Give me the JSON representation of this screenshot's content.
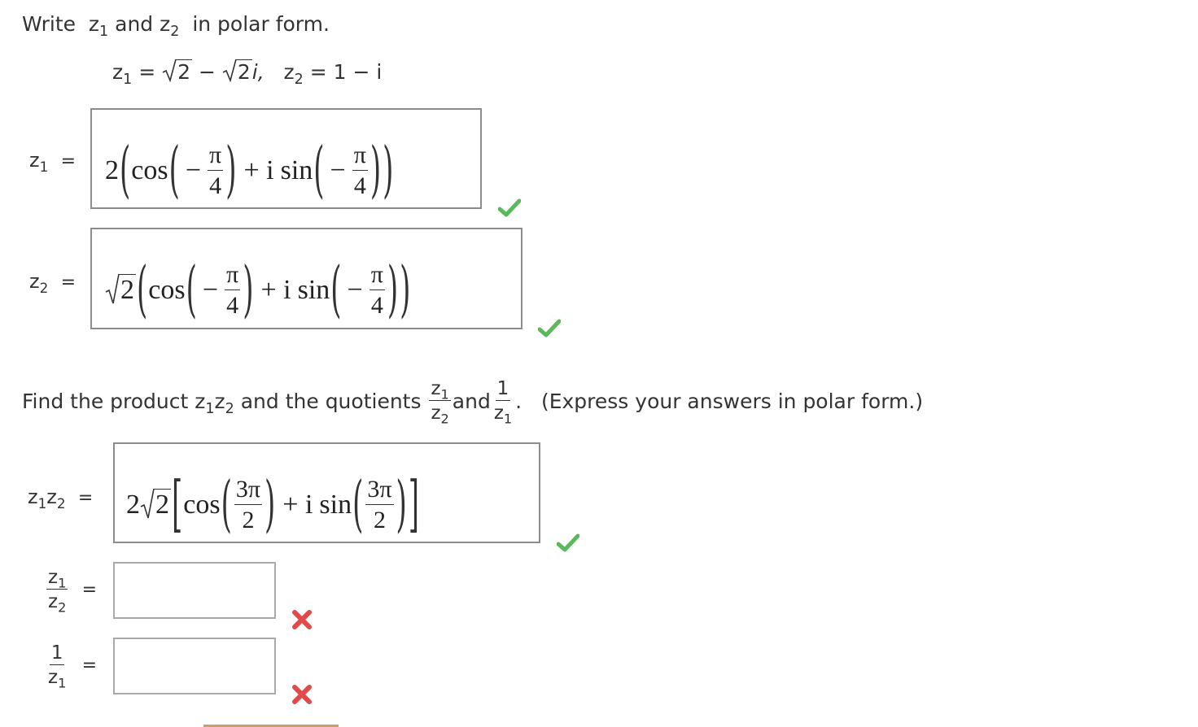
{
  "problem": {
    "prompt_prefix": "Write",
    "prompt_and": "and",
    "prompt_suffix": "in polar form.",
    "z1_label": "z",
    "z2_label": "z",
    "sub1": "1",
    "sub2": "2",
    "given_z1_eq": "=",
    "given_two": "2",
    "given_minus": "−",
    "given_two_i": "2",
    "given_i": "i,",
    "given_z2_rhs": "= 1 − i"
  },
  "answers_part1": {
    "z1": {
      "label": "z",
      "sub": "1",
      "equals": "=",
      "value": {
        "coef": "2",
        "cos": "cos",
        "sin": "sin",
        "plus_i": "+ i",
        "minus": "−",
        "num": "π",
        "den": "4"
      },
      "status": "correct"
    },
    "z2": {
      "label": "z",
      "sub": "2",
      "equals": "=",
      "value": {
        "coef": "2",
        "cos": "cos",
        "sin": "sin",
        "plus_i": "+ i",
        "minus": "−",
        "num": "π",
        "den": "4"
      },
      "status": "correct"
    }
  },
  "part2": {
    "text_find": "Find the product",
    "text_and_quotients": "and the quotients",
    "text_and": "and",
    "text_one": "1",
    "text_express": "(Express your answers in polar form.)",
    "product": {
      "equals": "=",
      "value": {
        "coef": "2",
        "sqrt_arg": "2",
        "cos": "cos",
        "sin": "sin",
        "plus_i": "+ i",
        "num": "3π",
        "den": "2"
      },
      "status": "correct"
    },
    "quotient": {
      "equals": "=",
      "value": "",
      "status": "incorrect"
    },
    "reciprocal": {
      "equals": "=",
      "one": "1",
      "value": "",
      "status": "incorrect"
    }
  },
  "colors": {
    "correct": "#5cb85c",
    "incorrect": "#e24a4a",
    "box_border": "#a9a9a9",
    "text": "#333333"
  },
  "icons": {
    "correct": "check-icon",
    "incorrect": "x-icon"
  }
}
